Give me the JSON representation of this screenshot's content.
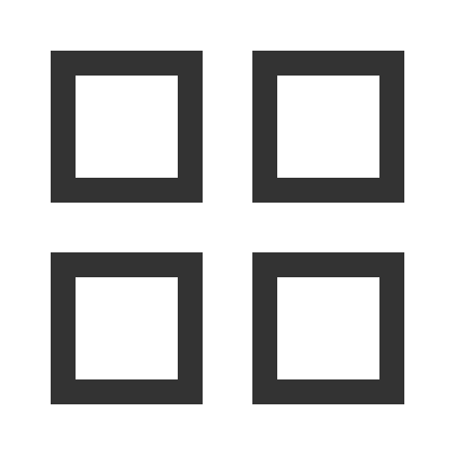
{
  "icon": {
    "name": "grid-view-icon",
    "color": "#333333",
    "background": "#ffffff"
  }
}
